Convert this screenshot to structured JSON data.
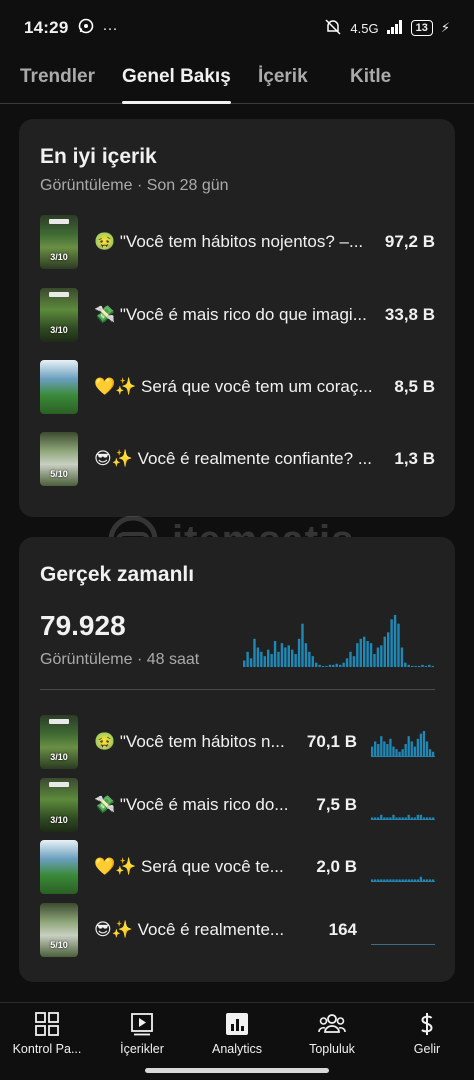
{
  "status_bar": {
    "time": "14:29",
    "network": "4.5G",
    "battery": "13"
  },
  "tabs": [
    {
      "label": "Trendler"
    },
    {
      "label": "Genel Bakış"
    },
    {
      "label": "İçerik"
    },
    {
      "label": "Kitle"
    }
  ],
  "top_content": {
    "title": "En iyi içerik",
    "subtitle": "Görüntüleme · Son 28 gün",
    "items": [
      {
        "title": "🤢 \"Você tem hábitos nojentos? –...",
        "value": "97,2 B",
        "thumb_text": "3/10"
      },
      {
        "title": "💸 \"Você é mais rico do que imagi...",
        "value": "33,8 B",
        "thumb_text": "3/10"
      },
      {
        "title": "💛✨ Será que você tem um coraç...",
        "value": "8,5 B",
        "thumb_text": ""
      },
      {
        "title": "😎✨ Você é realmente confiante? ...",
        "value": "1,3 B",
        "thumb_text": "5/10"
      }
    ]
  },
  "realtime": {
    "title": "Gerçek zamanlı",
    "total": "79.928",
    "subtitle": "Görüntüleme · 48 saat",
    "chart_color": "#1e88b6",
    "bars": [
      6,
      14,
      8,
      26,
      18,
      14,
      10,
      16,
      12,
      24,
      14,
      22,
      18,
      20,
      16,
      12,
      26,
      40,
      22,
      14,
      10,
      4,
      2,
      1,
      1,
      2,
      2,
      3,
      2,
      4,
      8,
      14,
      10,
      22,
      26,
      28,
      24,
      22,
      12,
      18,
      20,
      28,
      32,
      44,
      48,
      40,
      18,
      4,
      2,
      1,
      1,
      1,
      2,
      1,
      2,
      1
    ],
    "items": [
      {
        "title": "🤢 \"Você tem hábitos n...",
        "value": "70,1 B",
        "thumb_text": "3/10",
        "spark": [
          4,
          6,
          5,
          8,
          6,
          5,
          7,
          4,
          3,
          2,
          3,
          5,
          8,
          6,
          4,
          7,
          9,
          10,
          6,
          3,
          2
        ]
      },
      {
        "title": "💸 \"Você é mais rico do...",
        "value": "7,5 B",
        "thumb_text": "3/10",
        "spark": [
          1,
          1,
          1,
          2,
          1,
          1,
          1,
          2,
          1,
          1,
          1,
          1,
          2,
          1,
          1,
          2,
          2,
          1,
          1,
          1,
          1
        ]
      },
      {
        "title": "💛✨ Será que você te...",
        "value": "2,0 B",
        "thumb_text": "",
        "spark": [
          1,
          1,
          1,
          1,
          1,
          1,
          1,
          1,
          1,
          1,
          1,
          1,
          1,
          1,
          1,
          1,
          2,
          1,
          1,
          1,
          1
        ]
      },
      {
        "title": "😎✨ Você é realmente...",
        "value": "164",
        "thumb_text": "5/10",
        "spark": [
          0,
          0,
          0,
          0,
          0,
          0,
          0,
          0,
          0,
          0,
          0,
          0,
          0,
          0,
          0,
          0,
          0,
          0,
          0,
          0,
          0
        ]
      }
    ]
  },
  "watermark": "itemsatis",
  "bottom_nav": [
    {
      "label": "Kontrol Pa...",
      "icon": "dashboard-icon"
    },
    {
      "label": "İçerikler",
      "icon": "content-icon"
    },
    {
      "label": "Analytics",
      "icon": "analytics-icon"
    },
    {
      "label": "Topluluk",
      "icon": "community-icon"
    },
    {
      "label": "Gelir",
      "icon": "earn-icon"
    }
  ]
}
